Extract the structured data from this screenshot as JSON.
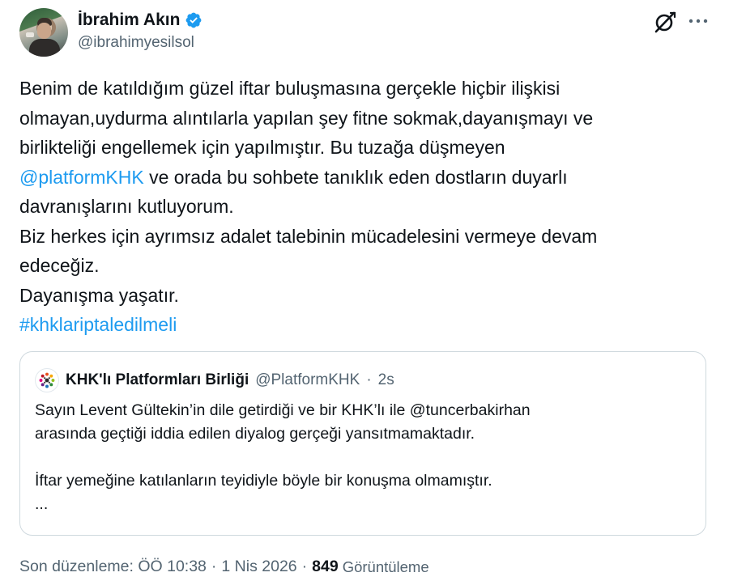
{
  "author": {
    "display_name": "İbrahim Akın",
    "handle": "@ibrahimyesilsol",
    "verified": true,
    "verified_color": "#1d9bf0"
  },
  "actions": {
    "grok_icon": "grok-icon",
    "more_icon": "more-icon"
  },
  "tweet": {
    "line1": "Benim de katıldığım güzel iftar buluşmasına gerçekle hiçbir ilişkisi",
    "line2": "olmayan,uydurma alıntılarla yapılan şey fitne sokmak,dayanışmayı ve",
    "line3": "birlikteliği engellemek için yapılmıştır. Bu tuzağa düşmeyen",
    "mention": "@platformKHK",
    "line4_rest": " ve orada bu sohbete tanıklık eden dostların duyarlı",
    "line5": "davranışlarını kutluyorum.",
    "line6": "Biz herkes için ayrımsız adalet talebinin mücadelesini vermeye devam",
    "line7": "edeceğiz.",
    "line8": "Dayanışma yaşatır.",
    "hashtag": "#khklariptaledilmeli",
    "link_color": "#1d9bf0"
  },
  "quote": {
    "name": "KHK'lı Platformları Birliği",
    "handle": "@PlatformKHK",
    "separator": "·",
    "time": "2s",
    "text_line1": "Sayın Levent Gültekin’in dile getirdiği ve bir KHK’lı ile @tuncerbakirhan",
    "text_line2": "arasında geçtiği iddia edilen diyalog gerçeği yansıtmamaktadır.",
    "text_line3": "İftar yemeğine katılanların teyidiyle böyle bir konuşma olmamıştır.",
    "ellipsis": "..."
  },
  "meta": {
    "edited_label": "Son düzenleme: ÖÖ 10:38",
    "sep1": "·",
    "date": "1 Nis 2026",
    "sep2": "·",
    "views_count": "849",
    "views_label": "Görüntüleme"
  }
}
